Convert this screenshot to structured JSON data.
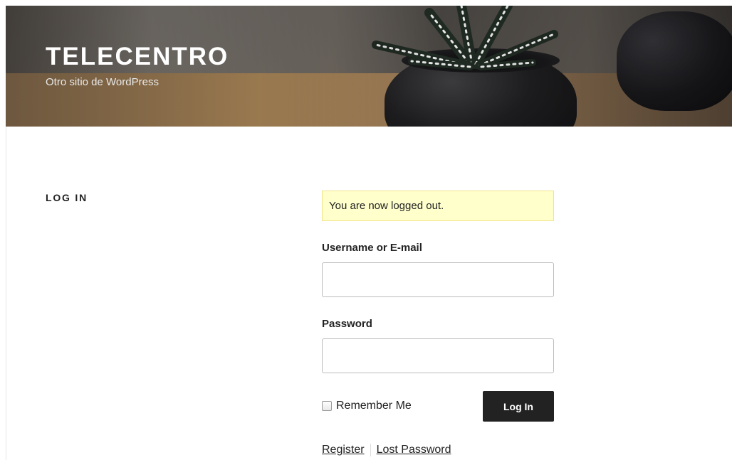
{
  "site": {
    "title": "TELECENTRO",
    "description": "Otro sitio de WordPress"
  },
  "page": {
    "title": "LOG IN"
  },
  "notice": {
    "text": "You are now logged out."
  },
  "form": {
    "username_label": "Username or E-mail",
    "username_value": "",
    "password_label": "Password",
    "password_value": "",
    "remember_label": "Remember Me",
    "remember_checked": false,
    "submit_label": "Log In"
  },
  "links": {
    "register": "Register",
    "lost_password": "Lost Password"
  },
  "colors": {
    "button_bg": "#222222",
    "notice_bg": "#ffffcc",
    "notice_border": "#efe48c",
    "text": "#222222"
  }
}
